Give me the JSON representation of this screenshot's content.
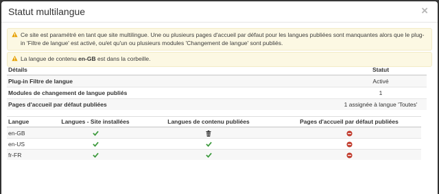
{
  "modal": {
    "title": "Statut multilangue",
    "close_glyph": "×"
  },
  "alerts": [
    {
      "text": "Ce site est paramétré en tant que site multilingue. Une ou plusieurs pages d'accueil par défaut pour les langues publiées sont manquantes alors que le plug-in 'Filtre de langue' est activé, ou/et qu'un ou plusieurs modules 'Changement de langue' sont publiés."
    },
    {
      "prefix": "La langue de contenu ",
      "bold": "en-GB",
      "suffix": " est dans la corbeille."
    }
  ],
  "details_table": {
    "headers": [
      "Détails",
      "Statut"
    ],
    "rows": [
      {
        "label": "Plug-in Filtre de langue",
        "status": "Activé"
      },
      {
        "label": "Modules de changement de langue publiés",
        "status": "1"
      },
      {
        "label": "Pages d'accueil par défaut publiées",
        "status": "1 assignée à langue 'Toutes'"
      }
    ]
  },
  "languages_table": {
    "headers": [
      "Langue",
      "Langues - Site installées",
      "Langues de contenu publiées",
      "Pages d'accueil par défaut publiées"
    ],
    "rows": [
      {
        "lang": "en-GB",
        "site": "check-icon",
        "content": "trash-icon",
        "home": "minus-circle-icon"
      },
      {
        "lang": "en-US",
        "site": "check-icon",
        "content": "check-icon",
        "home": "minus-circle-icon"
      },
      {
        "lang": "fr-FR",
        "site": "check-icon",
        "content": "check-icon",
        "home": "minus-circle-icon"
      }
    ]
  },
  "colors": {
    "alert_bg": "#fcf8e3",
    "warning_icon": "#e6a000",
    "check": "#3c9a3c",
    "remove": "#c0392b"
  }
}
